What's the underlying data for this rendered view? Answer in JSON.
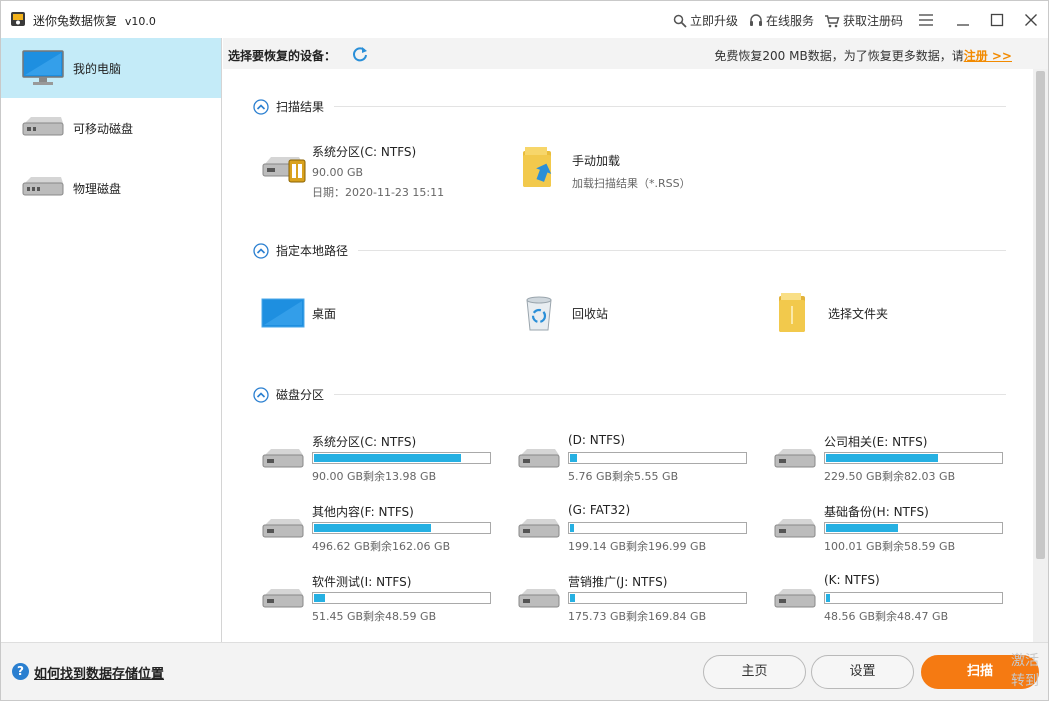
{
  "titlebar": {
    "app_name": "迷你兔数据恢复",
    "version": "v10.0",
    "upgrade": "立即升级",
    "online_service": "在线服务",
    "get_code": "获取注册码"
  },
  "sidebar": {
    "items": [
      {
        "label": "我的电脑",
        "icon": "monitor-icon",
        "active": true
      },
      {
        "label": "可移动磁盘",
        "icon": "removable-disk-icon",
        "active": false
      },
      {
        "label": "物理磁盘",
        "icon": "physical-disk-icon",
        "active": false
      }
    ]
  },
  "header": {
    "select_label": "选择要恢复的设备：",
    "free_note": "免费恢复200 MB数据，为了恢复更多数据，请",
    "register_link": "注册 >>"
  },
  "sections": {
    "scan_results": {
      "title": "扫描结果",
      "partition": {
        "name": "系统分区(C: NTFS)",
        "size": "90.00 GB",
        "date": "日期：2020-11-23 15:11"
      },
      "manual_load": {
        "title": "手动加载",
        "sub": "加载扫描结果（*.RSS）"
      }
    },
    "local_path": {
      "title": "指定本地路径",
      "items": [
        {
          "label": "桌面",
          "icon": "desktop-icon"
        },
        {
          "label": "回收站",
          "icon": "recycle-bin-icon"
        },
        {
          "label": "选择文件夹",
          "icon": "folder-icon"
        }
      ]
    },
    "partitions": {
      "title": "磁盘分区",
      "items": [
        {
          "name": "系统分区(C: NTFS)",
          "size": "90.00 GB剩余13.98 GB",
          "used": 0.84
        },
        {
          "name": "(D: NTFS)",
          "size": "5.76 GB剩余5.55 GB",
          "used": 0.04
        },
        {
          "name": "公司相关(E: NTFS)",
          "size": "229.50 GB剩余82.03 GB",
          "used": 0.64
        },
        {
          "name": "其他内容(F: NTFS)",
          "size": "496.62 GB剩余162.06 GB",
          "used": 0.67
        },
        {
          "name": "(G: FAT32)",
          "size": "199.14 GB剩余196.99 GB",
          "used": 0.01
        },
        {
          "name": "基础备份(H: NTFS)",
          "size": "100.01 GB剩余58.59 GB",
          "used": 0.41
        },
        {
          "name": "软件测试(I: NTFS)",
          "size": "51.45 GB剩余48.59 GB",
          "used": 0.06
        },
        {
          "name": "营销推广(J: NTFS)",
          "size": "175.73 GB剩余169.84 GB",
          "used": 0.03
        },
        {
          "name": "(K: NTFS)",
          "size": "48.56 GB剩余48.47 GB",
          "used": 0.0
        }
      ]
    }
  },
  "footer": {
    "help_link": "如何找到数据存储位置",
    "home": "主页",
    "settings": "设置",
    "scan": "扫描"
  },
  "watermark": [
    "激活",
    "转到"
  ],
  "colors": {
    "accent": "#26b0e2",
    "brand_orange": "#f57a12",
    "active_bg": "#c4ebf8",
    "register": "#f28a00"
  }
}
